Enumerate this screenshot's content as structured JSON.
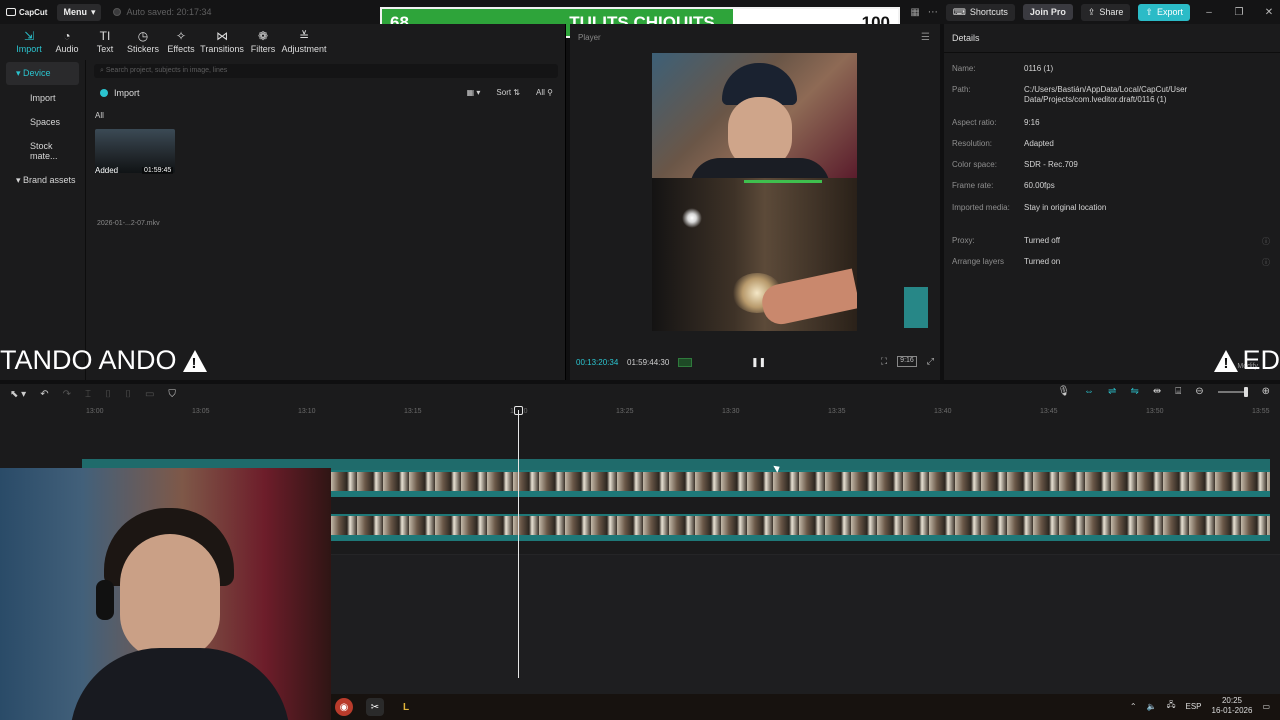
{
  "app": {
    "logo": "CapCut",
    "menu_label": "Menu",
    "autosave": "Auto saved: 20:17:34",
    "shortcuts": "Shortcuts",
    "join_pro": "Join Pro",
    "share": "Share",
    "export": "Export"
  },
  "score": {
    "current": "68",
    "name": "TULITS CHIQUITS",
    "max": "100",
    "progress": 0.68,
    "color": "#2ea43a"
  },
  "tools": [
    {
      "label": "Import",
      "icon": "import-icon",
      "active": true
    },
    {
      "label": "Audio",
      "icon": "audio-icon"
    },
    {
      "label": "Text",
      "icon": "text-icon"
    },
    {
      "label": "Stickers",
      "icon": "stickers-icon"
    },
    {
      "label": "Effects",
      "icon": "effects-icon"
    },
    {
      "label": "Transitions",
      "icon": "transitions-icon"
    },
    {
      "label": "Filters",
      "icon": "filters-icon"
    },
    {
      "label": "Adjustment",
      "icon": "adjustment-icon"
    }
  ],
  "sidebar": [
    {
      "label": "Device",
      "active": true
    },
    {
      "label": "Import"
    },
    {
      "label": "Spaces"
    },
    {
      "label": "Stock mate..."
    },
    {
      "label": "Brand assets",
      "caret": true
    }
  ],
  "media": {
    "search_placeholder": "Search project, subjects in image, lines",
    "import_label": "Import",
    "sort_label": "Sort",
    "all_filter": "All",
    "all_label": "All",
    "item_added": "Added",
    "item_duration": "01:59:45",
    "item_name": "2026-01-...2-07.mkv"
  },
  "player": {
    "title": "Player",
    "current_time": "00:13:20:34",
    "total_time": "01:59:44:30",
    "ratio": "9:16"
  },
  "details": {
    "title": "Details",
    "rows": [
      {
        "key": "Name:",
        "value": "0116 (1)"
      },
      {
        "key": "Path:",
        "value": "C:/Users/Bastián/AppData/Local/CapCut/User Data/Projects/com.lveditor.draft/0116 (1)"
      },
      {
        "key": "Aspect ratio:",
        "value": "9:16"
      },
      {
        "key": "Resolution:",
        "value": "Adapted"
      },
      {
        "key": "Color space:",
        "value": "SDR - Rec.709"
      },
      {
        "key": "Frame rate:",
        "value": "60.00fps"
      },
      {
        "key": "Imported media:",
        "value": "Stay in original location"
      },
      {
        "key": "Proxy:",
        "value": "Turned off"
      },
      {
        "key": "Arrange layers",
        "value": "Turned on"
      }
    ],
    "modify": "Modify"
  },
  "overlay": {
    "left_text": "TANDO ANDO",
    "right_text": "ED"
  },
  "timeline": {
    "ticks": [
      "13:00",
      "13:05",
      "13:10",
      "13:15",
      "13:20",
      "13:25",
      "13:30",
      "13:35",
      "13:40",
      "13:45",
      "13:50",
      "13:55"
    ]
  },
  "taskbar": {
    "lang": "ESP",
    "time": "20:25",
    "date": "16-01-2026"
  },
  "colors": {
    "accent": "#2bc4cf",
    "track": "#1e7878",
    "export": "#2bbbc7"
  }
}
